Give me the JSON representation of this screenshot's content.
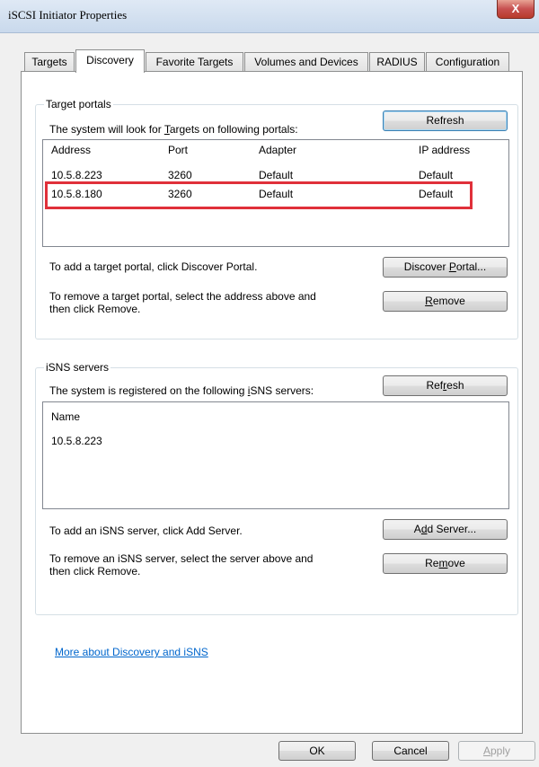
{
  "window": {
    "title": "iSCSI Initiator Properties",
    "close_glyph": "X"
  },
  "tabs": [
    {
      "label": "Targets",
      "active": false
    },
    {
      "label": "Discovery",
      "active": true
    },
    {
      "label": "Favorite Targets",
      "active": false
    },
    {
      "label": "Volumes and Devices",
      "active": false
    },
    {
      "label": "RADIUS",
      "active": false
    },
    {
      "label": "Configuration",
      "active": false
    }
  ],
  "target_portals": {
    "group_label": "Target portals",
    "description_pre": "The system will look for ",
    "description_ul": "T",
    "description_post": "argets on following portals:",
    "refresh_label": "Refresh",
    "columns": [
      "Address",
      "Port",
      "Adapter",
      "IP address"
    ],
    "rows": [
      {
        "address": "10.5.8.223",
        "port": "3260",
        "adapter": "Default",
        "ip": "Default"
      },
      {
        "address": "10.5.8.180",
        "port": "3260",
        "adapter": "Default",
        "ip": "Default"
      }
    ],
    "add_text": "To add a target portal, click Discover Portal.",
    "discover_pre": "Discover ",
    "discover_ul": "P",
    "discover_post": "ortal...",
    "remove_text_line1": "To remove a target portal, select the address above and",
    "remove_text_line2": "then click Remove.",
    "remove_ul": "R",
    "remove_post": "emove"
  },
  "isns_servers": {
    "group_label": "iSNS servers",
    "description_pre": "The system is registered on the following ",
    "description_ul": "i",
    "description_post": "SNS servers:",
    "refresh_pre": "Ref",
    "refresh_ul": "r",
    "refresh_post": "esh",
    "column": "Name",
    "rows": [
      "10.5.8.223"
    ],
    "add_text": "To add an iSNS server, click Add Server.",
    "add_pre": "A",
    "add_ul": "d",
    "add_post": "d Server...",
    "remove_text_line1": "To remove an iSNS server, select the server above and",
    "remove_text_line2": "then click Remove.",
    "remove_pre": "Re",
    "remove_ul": "m",
    "remove_post": "ove"
  },
  "link_text": "More about Discovery and iSNS",
  "footer": {
    "ok_label": "OK",
    "cancel_label": "Cancel",
    "apply_ul": "A",
    "apply_post": "pply"
  }
}
